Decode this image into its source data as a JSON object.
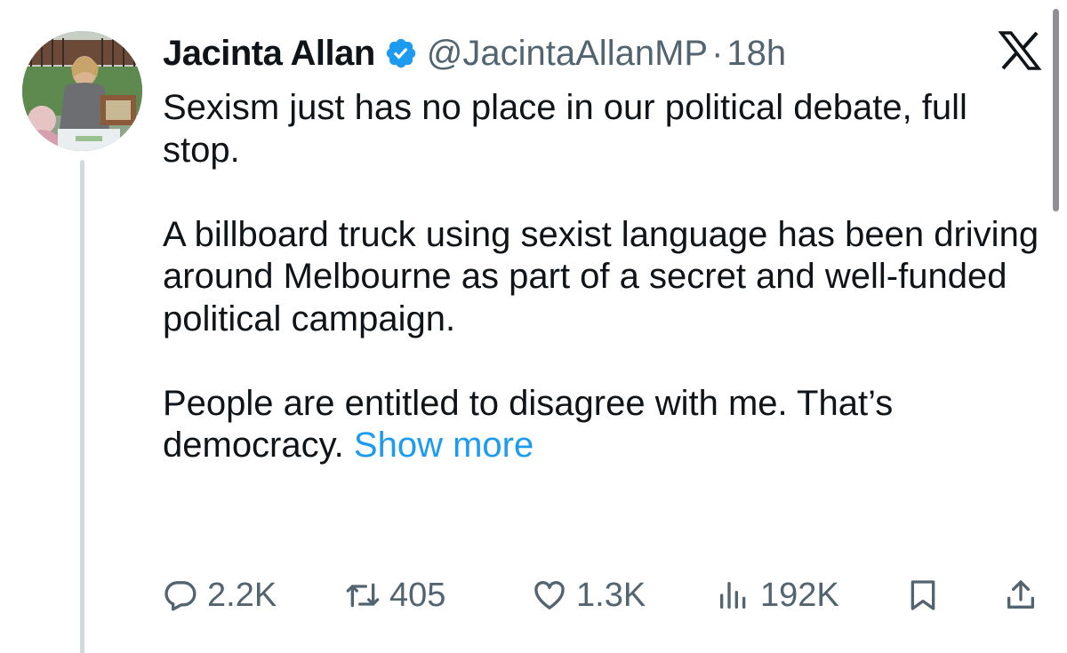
{
  "tweet": {
    "author": {
      "display_name": "Jacinta Allan",
      "handle": "@JacintaAllanMP",
      "verified": true
    },
    "separator": "·",
    "time_ago": "18h",
    "text_paragraphs": [
      "Sexism just has no place in our political debate, full stop.",
      "A billboard truck using sexist language has been driving around Melbourne as part of a secret and well-funded political campaign.",
      "People are entitled to disagree with me. That’s democracy."
    ],
    "show_more_label": "Show more",
    "stats": {
      "replies": "2.2K",
      "retweets": "405",
      "likes": "1.3K",
      "views": "192K"
    }
  },
  "colors": {
    "text": "#0f1419",
    "secondary": "#536471",
    "link": "#1d9bf0",
    "verified_badge": "#1d9bf0",
    "thread_line": "#cfd9de"
  },
  "icons": {
    "verified": "verified-badge-icon",
    "platform": "x-logo-icon",
    "reply": "reply-bubble-icon",
    "retweet": "retweet-arrows-icon",
    "like": "heart-icon",
    "views": "bar-chart-icon",
    "bookmark": "bookmark-icon",
    "share": "share-upload-icon"
  }
}
